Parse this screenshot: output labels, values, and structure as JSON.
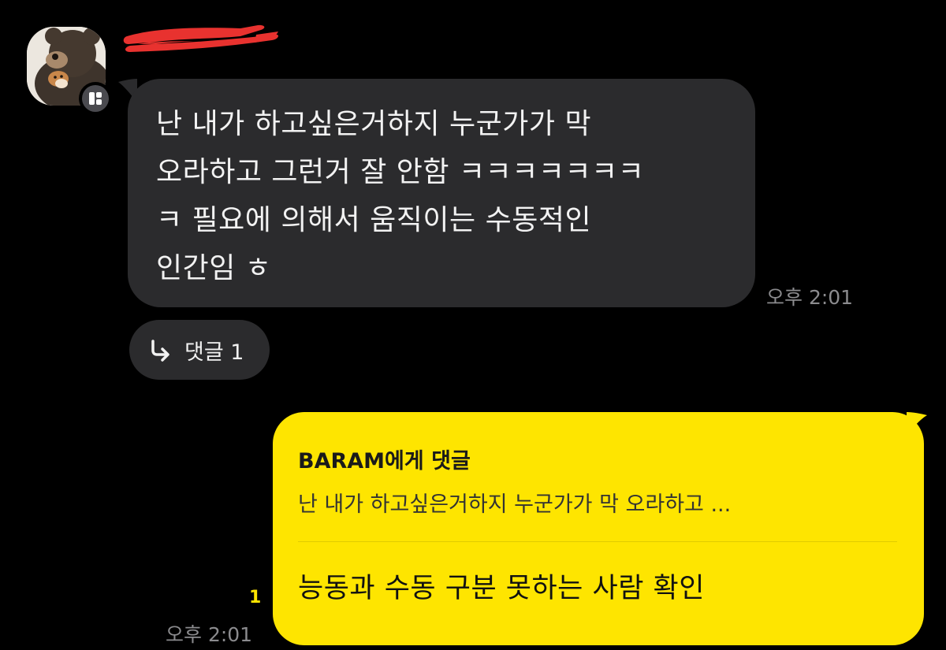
{
  "incoming_message": {
    "lines": [
      "난 내가 하고싶은거하지 누군가가 막",
      "오라하고 그런거 잘 안함 ㅋㅋㅋㅋㅋㅋㅋ",
      "ㅋ 필요에 의해서 움직이는 수동적인",
      "인간임 ㅎ"
    ],
    "time": "오후 2:01",
    "bubble_color": "#2b2b2d"
  },
  "reply_chip": {
    "icon": "reply-arrow-icon",
    "label": "댓글 1"
  },
  "outgoing_message": {
    "quote_title": "BARAM에게 댓글",
    "quote_preview": "난 내가 하고싶은거하지 누군가가 막 오라하고 ...",
    "text": "능동과 수동 구분 못하는 사람 확인",
    "unread_count": "1",
    "time": "오후 2:01",
    "bubble_color": "#fee500"
  },
  "sender": {
    "avatar_icon": "teddy-bear-avatar",
    "badge_icon": "profile-card-icon",
    "redaction_color": "#e8322f"
  },
  "colors": {
    "background": "#000000",
    "timestamp": "#8b8b8e",
    "unread": "#fee500"
  }
}
